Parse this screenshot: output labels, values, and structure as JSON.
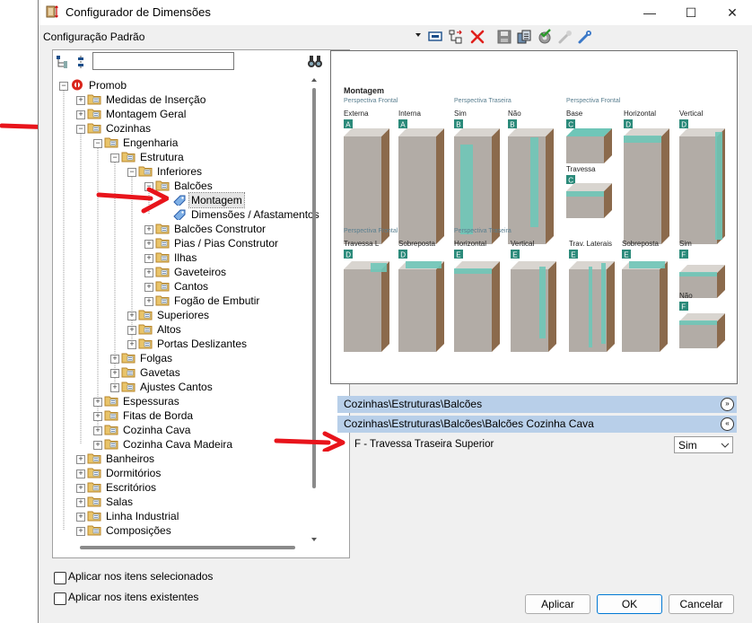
{
  "window": {
    "title": "Configurador de Dimensões",
    "min_glyph": "—",
    "max_glyph": "☐",
    "close_glyph": "✕"
  },
  "toolbar": {
    "config_label": "Configuração Padrão",
    "icons": [
      "dropdown-arrow-icon",
      "screen-icon",
      "tree-move-icon",
      "delete-x-icon",
      "save-disk-icon",
      "copy-icon",
      "check-settings-icon",
      "tool-disabled-icon",
      "tool-blue-icon"
    ]
  },
  "tree": {
    "search_value": "",
    "search_icon": "binoculars-icon",
    "items": [
      {
        "label": "Promob",
        "level": 0,
        "expanded": true
      },
      {
        "label": "Medidas de Inserção",
        "level": 1,
        "expanded": false
      },
      {
        "label": "Montagem Geral",
        "level": 1,
        "expanded": false
      },
      {
        "label": "Cozinhas",
        "level": 1,
        "expanded": true
      },
      {
        "label": "Engenharia",
        "level": 2,
        "expanded": true
      },
      {
        "label": "Estrutura",
        "level": 3,
        "expanded": true
      },
      {
        "label": "Inferiores",
        "level": 4,
        "expanded": true
      },
      {
        "label": "Balcões",
        "level": 5,
        "expanded": true
      },
      {
        "label": "Montagem",
        "level": 6,
        "leaf": true,
        "selected": true
      },
      {
        "label": "Dimensões / Afastamentos",
        "level": 6,
        "leaf": true
      },
      {
        "label": "Balcões Construtor",
        "level": 5,
        "expanded": false
      },
      {
        "label": "Pias / Pias Construtor",
        "level": 5,
        "expanded": false
      },
      {
        "label": "Ilhas",
        "level": 5,
        "expanded": false
      },
      {
        "label": "Gaveteiros",
        "level": 5,
        "expanded": false
      },
      {
        "label": "Cantos",
        "level": 5,
        "expanded": false
      },
      {
        "label": "Fogão de Embutir",
        "level": 5,
        "expanded": false
      },
      {
        "label": "Superiores",
        "level": 4,
        "expanded": false
      },
      {
        "label": "Altos",
        "level": 4,
        "expanded": false
      },
      {
        "label": "Portas Deslizantes",
        "level": 4,
        "expanded": false
      },
      {
        "label": "Folgas",
        "level": 3,
        "expanded": false
      },
      {
        "label": "Gavetas",
        "level": 3,
        "expanded": false
      },
      {
        "label": "Ajustes Cantos",
        "level": 3,
        "expanded": false
      },
      {
        "label": "Espessuras",
        "level": 2,
        "expanded": false
      },
      {
        "label": "Fitas de Borda",
        "level": 2,
        "expanded": false
      },
      {
        "label": "Cozinha Cava",
        "level": 2,
        "expanded": false
      },
      {
        "label": "Cozinha Cava Madeira",
        "level": 2,
        "expanded": false
      },
      {
        "label": "Banheiros",
        "level": 1,
        "expanded": false
      },
      {
        "label": "Dormitórios",
        "level": 1,
        "expanded": false
      },
      {
        "label": "Escritórios",
        "level": 1,
        "expanded": false
      },
      {
        "label": "Salas",
        "level": 1,
        "expanded": false
      },
      {
        "label": "Linha Industrial",
        "level": 1,
        "expanded": false
      },
      {
        "label": "Composições",
        "level": 1,
        "expanded": false
      }
    ]
  },
  "preview": {
    "heading": "Montagem",
    "row1_persp": [
      "Perspectiva Frontal",
      "Perspectiva Traseira",
      "Perspectiva Frontal"
    ],
    "row1": [
      {
        "label": "Externa",
        "letter": "A"
      },
      {
        "label": "Interna",
        "letter": "A"
      },
      {
        "label": "Sim",
        "letter": "B"
      },
      {
        "label": "Não",
        "letter": "B"
      },
      {
        "label": "Base",
        "letter": "C"
      },
      {
        "label": "Horizontal",
        "letter": "D"
      },
      {
        "label": "Vertical",
        "letter": "D"
      }
    ],
    "travessa": {
      "label": "Travessa",
      "letter": "C"
    },
    "row2_persp": [
      "Perspectiva Frontal",
      "Perspectiva Traseira"
    ],
    "row2": [
      {
        "label": "Travessa L",
        "letter": "D"
      },
      {
        "label": "Sobreposta",
        "letter": "D"
      },
      {
        "label": "Horizontal",
        "letter": "E"
      },
      {
        "label": "Vertical",
        "letter": "E"
      },
      {
        "label": "Trav. Laterais",
        "letter": "E"
      },
      {
        "label": "Sobreposta",
        "letter": "E"
      },
      {
        "label": "Sim",
        "letter": "F"
      }
    ],
    "nao": {
      "label": "Não",
      "letter": "F"
    },
    "colors": {
      "wood": "#8b6a4c",
      "gray": "#b2aca6",
      "teal": "#6fc6b8",
      "chip": "#2b8a7a"
    }
  },
  "groups": [
    {
      "label": "Cozinhas\\Estruturas\\Balcões",
      "chevron": "»"
    },
    {
      "label": "Cozinhas\\Estruturas\\Balcões\\Balcões Cozinha Cava",
      "chevron": "«"
    }
  ],
  "property": {
    "name": "F - Travessa Traseira Superior",
    "value": "Sim"
  },
  "options": {
    "apply_selected": "Aplicar nos itens selecionados",
    "apply_existing": "Aplicar nos itens existentes"
  },
  "buttons": {
    "apply": "Aplicar",
    "ok": "OK",
    "cancel": "Cancelar"
  }
}
